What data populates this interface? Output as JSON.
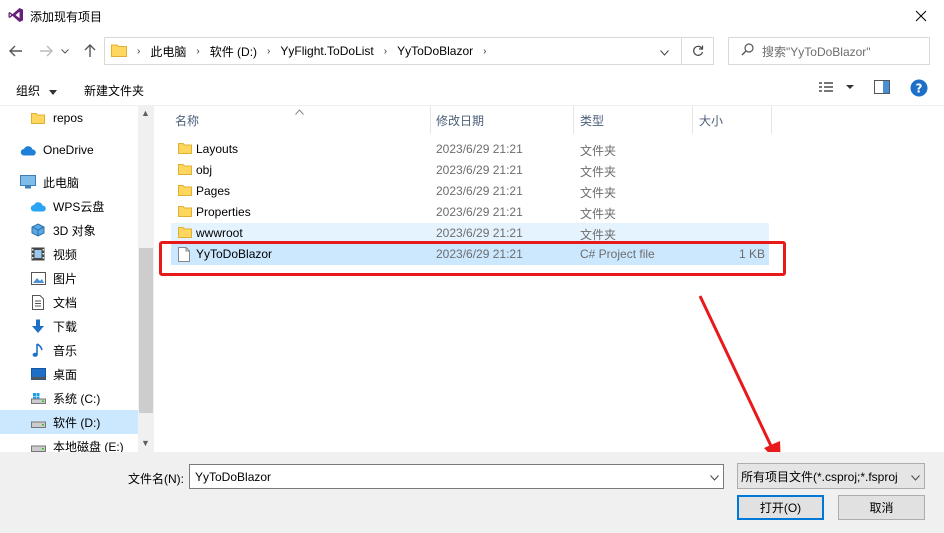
{
  "window": {
    "title": "添加现有项目"
  },
  "nav": {
    "breadcrumbs": [
      "此电脑",
      "软件 (D:)",
      "YyFlight.ToDoList",
      "YyToDoBlazor"
    ],
    "search_placeholder": "搜索\"YyToDoBlazor\""
  },
  "toolbar": {
    "organize": "组织",
    "new_folder": "新建文件夹"
  },
  "sidebar": {
    "items": [
      {
        "label": "repos",
        "icon": "folder-icon"
      },
      {
        "label": "OneDrive",
        "icon": "cloud-icon"
      },
      {
        "label": "此电脑",
        "icon": "computer-icon"
      },
      {
        "label": "WPS云盘",
        "icon": "wps-cloud-icon"
      },
      {
        "label": "3D 对象",
        "icon": "3d-objects-icon"
      },
      {
        "label": "视频",
        "icon": "video-icon"
      },
      {
        "label": "图片",
        "icon": "picture-icon"
      },
      {
        "label": "文档",
        "icon": "document-icon"
      },
      {
        "label": "下载",
        "icon": "download-icon"
      },
      {
        "label": "音乐",
        "icon": "music-icon"
      },
      {
        "label": "桌面",
        "icon": "desktop-icon"
      },
      {
        "label": "系统 (C:)",
        "icon": "drive-icon"
      },
      {
        "label": "软件 (D:)",
        "icon": "drive-icon"
      },
      {
        "label": "本地磁盘 (E:)",
        "icon": "drive-icon"
      }
    ],
    "selected_index": 12
  },
  "columns": {
    "name": "名称",
    "modified": "修改日期",
    "type": "类型",
    "size": "大小"
  },
  "files": [
    {
      "name": "Layouts",
      "modified": "2023/6/29 21:21",
      "type": "文件夹",
      "size": "",
      "icon": "folder-icon"
    },
    {
      "name": "obj",
      "modified": "2023/6/29 21:21",
      "type": "文件夹",
      "size": "",
      "icon": "folder-icon"
    },
    {
      "name": "Pages",
      "modified": "2023/6/29 21:21",
      "type": "文件夹",
      "size": "",
      "icon": "folder-icon"
    },
    {
      "name": "Properties",
      "modified": "2023/6/29 21:21",
      "type": "文件夹",
      "size": "",
      "icon": "folder-icon"
    },
    {
      "name": "wwwroot",
      "modified": "2023/6/29 21:21",
      "type": "文件夹",
      "size": "",
      "icon": "folder-icon"
    },
    {
      "name": "YyToDoBlazor",
      "modified": "2023/6/29 21:21",
      "type": "C# Project file",
      "size": "1 KB",
      "icon": "file-icon"
    }
  ],
  "footer": {
    "filename_label": "文件名(N):",
    "filename_value": "YyToDoBlazor",
    "filter_value": "所有项目文件(*.csproj;*.fsproj",
    "open_label": "打开(O)",
    "cancel_label": "取消"
  },
  "colors": {
    "selection": "#cce8ff",
    "hover": "#e5f3ff",
    "annotation": "#e8191b",
    "accent": "#0078d7"
  }
}
